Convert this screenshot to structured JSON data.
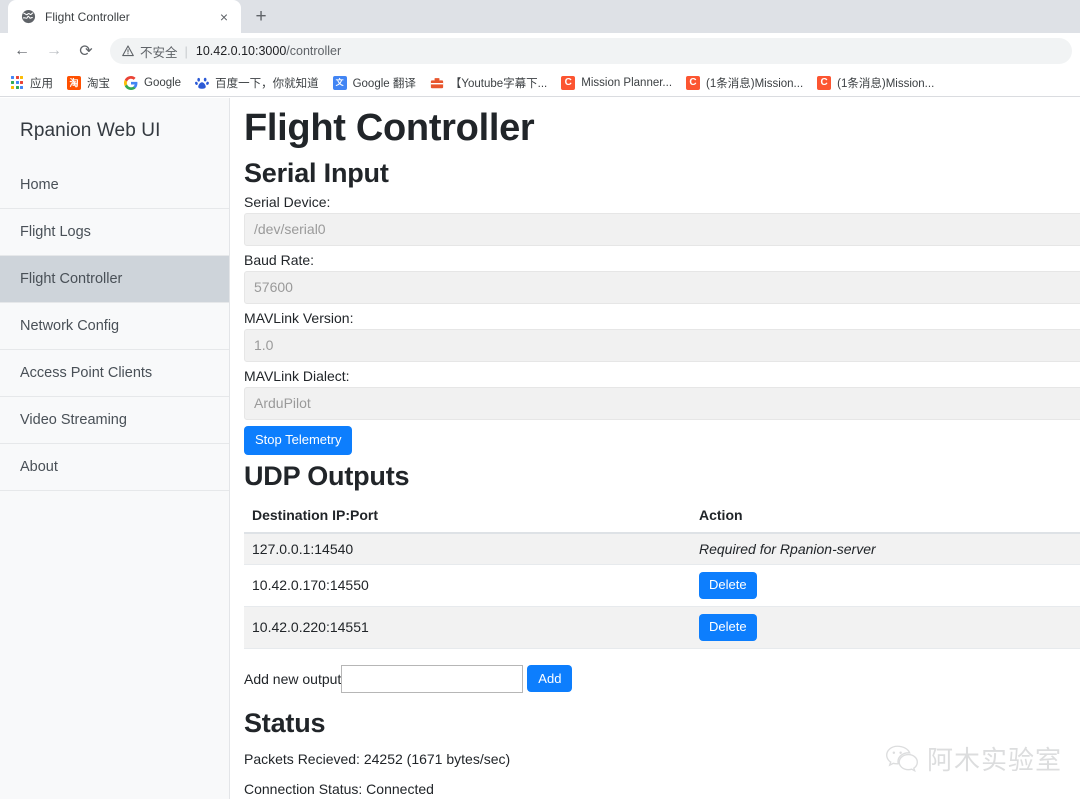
{
  "browser": {
    "tab": {
      "title": "Flight Controller",
      "favicon": "globe-icon",
      "close_label": "×"
    },
    "new_tab_label": "+",
    "nav": {
      "back": "←",
      "forward": "→",
      "reload": "⟳"
    },
    "omnibox": {
      "security_label": "不安全",
      "separator": "|",
      "url_host": "10.42.0.10:3000",
      "url_path": "/controller"
    },
    "bookmarks": [
      {
        "label": "应用",
        "icon": "apps-grid-icon"
      },
      {
        "label": "淘宝",
        "icon": "taobao-icon"
      },
      {
        "label": "Google",
        "icon": "google-g-icon"
      },
      {
        "label": "百度一下，你就知道",
        "icon": "baidu-icon"
      },
      {
        "label": "Google 翻译",
        "icon": "google-translate-icon"
      },
      {
        "label": "【Youtube字幕下...",
        "icon": "toolbox-icon"
      },
      {
        "label": "Mission Planner...",
        "icon": "csdn-c-icon"
      },
      {
        "label": "(1条消息)Mission...",
        "icon": "csdn-c-icon"
      },
      {
        "label": "(1条消息)Mission...",
        "icon": "csdn-c-icon"
      }
    ]
  },
  "sidebar": {
    "brand": "Rpanion Web UI",
    "items": [
      {
        "label": "Home",
        "active": false
      },
      {
        "label": "Flight Logs",
        "active": false
      },
      {
        "label": "Flight Controller",
        "active": true
      },
      {
        "label": "Network Config",
        "active": false
      },
      {
        "label": "Access Point Clients",
        "active": false
      },
      {
        "label": "Video Streaming",
        "active": false
      },
      {
        "label": "About",
        "active": false
      }
    ]
  },
  "main": {
    "page_title": "Flight Controller",
    "serial_input": {
      "heading": "Serial Input",
      "fields": [
        {
          "label": "Serial Device:",
          "value": "/dev/serial0"
        },
        {
          "label": "Baud Rate:",
          "value": "57600"
        },
        {
          "label": "MAVLink Version:",
          "value": "1.0"
        },
        {
          "label": "MAVLink Dialect:",
          "value": "ArduPilot"
        }
      ],
      "telemetry_button": "Stop Telemetry"
    },
    "udp_outputs": {
      "heading": "UDP Outputs",
      "columns": [
        "Destination IP:Port",
        "Action"
      ],
      "rows": [
        {
          "destination": "127.0.0.1:14540",
          "action_text": "Required for Rpanion-server",
          "action_type": "note"
        },
        {
          "destination": "10.42.0.170:14550",
          "action_text": "Delete",
          "action_type": "button"
        },
        {
          "destination": "10.42.0.220:14551",
          "action_text": "Delete",
          "action_type": "button"
        }
      ],
      "add_label": "Add new output",
      "add_input_value": "",
      "add_button": "Add"
    },
    "status": {
      "heading": "Status",
      "packets_line": "Packets Recieved: 24252 (1671 bytes/sec)",
      "connection_line": "Connection Status: Connected"
    }
  },
  "watermark": {
    "text": "阿木实验室",
    "icon": "wechat-icon"
  },
  "colors": {
    "accent_blue": "#0d7efd",
    "sidebar_bg": "#f8f9fa",
    "sidebar_active": "#ced4da",
    "input_bg": "#f1f1f1",
    "table_stripe": "#f2f2f2"
  }
}
